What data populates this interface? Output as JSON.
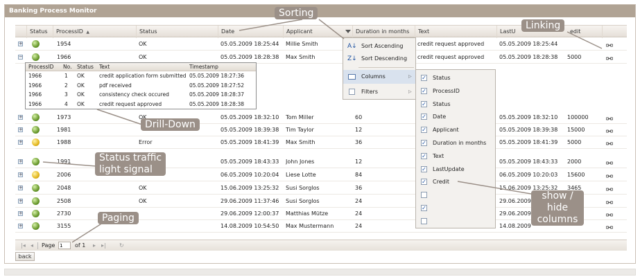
{
  "window": {
    "title": "Banking Process Monitor"
  },
  "grid": {
    "columns": [
      "Status",
      "ProcessID",
      "Status",
      "Date",
      "Applicant",
      "Duration in months",
      "Text",
      "LastU",
      "edit"
    ],
    "sort_indicator": "▲",
    "rows": [
      {
        "expander": "+",
        "light": "green",
        "id": "1954",
        "status": "OK",
        "date": "05.05.2009 18:25:44",
        "applicant": "Millie Smith",
        "duration": "",
        "text": "credit request approved",
        "lastupdate": "05.05.2009 18:25:44",
        "credit": ""
      },
      {
        "expander": "−",
        "light": "green",
        "id": "1966",
        "status": "OK",
        "date": "05.05.2009 18:28:38",
        "applicant": "Max Smith",
        "duration": "",
        "text": "credit request approved",
        "lastupdate": "05.05.2009 18:28:38",
        "credit": "5000"
      },
      {
        "expander": "+",
        "light": "green",
        "id": "1973",
        "status": "OK",
        "date": "05.05.2009 18:32:10",
        "applicant": "Tom Miller",
        "duration": "60",
        "text": "",
        "lastupdate": "05.05.2009 18:32:10",
        "credit": "100000"
      },
      {
        "expander": "+",
        "light": "green",
        "id": "1981",
        "status": "",
        "date": "05.05.2009 18:39:38",
        "applicant": "Tim Taylor",
        "duration": "12",
        "text": "",
        "lastupdate": "05.05.2009 18:39:38",
        "credit": "15000"
      },
      {
        "expander": "+",
        "light": "yellow",
        "id": "1988",
        "status": "Error",
        "date": "05.05.2009 18:41:39",
        "applicant": "Max Smith",
        "duration": "36",
        "text": "",
        "lastupdate": "05.05.2009 18:41:39",
        "credit": "5000"
      },
      {
        "expander": "+",
        "light": "green",
        "id": "1991",
        "status": "",
        "date": "05.05.2009 18:43:33",
        "applicant": "John Jones",
        "duration": "12",
        "text": "",
        "lastupdate": "05.05.2009 18:43:33",
        "credit": "2000"
      },
      {
        "expander": "+",
        "light": "yellow",
        "id": "2006",
        "status": "",
        "date": "06.05.2009 10:20:04",
        "applicant": "Liese Lotte",
        "duration": "84",
        "text": "",
        "lastupdate": "06.05.2009 10:20:03",
        "credit": "15600"
      },
      {
        "expander": "+",
        "light": "green",
        "id": "2048",
        "status": "OK",
        "date": "15.06.2009 13:25:32",
        "applicant": "Susi Sorglos",
        "duration": "36",
        "text": "",
        "lastupdate": "15.06.2009 13:25:32",
        "credit": "3465"
      },
      {
        "expander": "+",
        "light": "green",
        "id": "2508",
        "status": "OK",
        "date": "29.06.2009 11:37:46",
        "applicant": "Susi Sorglos",
        "duration": "24",
        "text": "",
        "lastupdate": "29.06.2009",
        "credit": ""
      },
      {
        "expander": "+",
        "light": "green",
        "id": "2730",
        "status": "",
        "date": "29.06.2009 12:00:37",
        "applicant": "Matthias Mütze",
        "duration": "24",
        "text": "",
        "lastupdate": "29.06.2009",
        "credit": ""
      },
      {
        "expander": "+",
        "light": "green",
        "id": "3155",
        "status": "",
        "date": "14.08.2009 10:54:50",
        "applicant": "Max Mustermann",
        "duration": "24",
        "text": "",
        "lastupdate": "14.08.2009",
        "credit": ""
      }
    ]
  },
  "detail": {
    "columns": [
      "ProcessID",
      "No.",
      "Status",
      "Text",
      "Timestamp"
    ],
    "rows": [
      {
        "pid": "1966",
        "no": "1",
        "status": "OK",
        "text": "credit application form submitted",
        "ts": "05.05.2009 18:27:36"
      },
      {
        "pid": "1966",
        "no": "2",
        "status": "OK",
        "text": "pdf received",
        "ts": "05.05.2009 18:27:52"
      },
      {
        "pid": "1966",
        "no": "3",
        "status": "OK",
        "text": "consistency check occured",
        "ts": "05.05.2009 18:28:37"
      },
      {
        "pid": "1966",
        "no": "4",
        "status": "OK",
        "text": "credit request approved",
        "ts": "05.05.2009 18:28:38"
      }
    ]
  },
  "column_menu": {
    "sort_asc": "Sort Ascending",
    "sort_desc": "Sort Descending",
    "columns": "Columns",
    "filters": "Filters",
    "arrow": "▷"
  },
  "columns_submenu": [
    {
      "label": "Status",
      "checked": true
    },
    {
      "label": "ProcessID",
      "checked": true
    },
    {
      "label": "Status",
      "checked": true
    },
    {
      "label": "Date",
      "checked": true
    },
    {
      "label": "Applicant",
      "checked": true
    },
    {
      "label": "Duration in months",
      "checked": true
    },
    {
      "label": "Text",
      "checked": true
    },
    {
      "label": "LastUpdate",
      "checked": true
    },
    {
      "label": "Credit",
      "checked": true
    },
    {
      "label": "",
      "checked": false
    },
    {
      "label": "",
      "checked": true
    },
    {
      "label": "",
      "checked": false
    }
  ],
  "callouts": {
    "sorting": "Sorting",
    "linking": "Linking",
    "drilldown": "Drill-Down",
    "status_l1": "Status traffic",
    "status_l2": "light signal",
    "paging": "Paging",
    "showhide_l1": "show /",
    "showhide_l2": "hide",
    "showhide_l3": "columns"
  },
  "pager": {
    "page_label": "Page",
    "page_value": "1",
    "of_label": "of 1"
  },
  "back_label": "back",
  "colors": {
    "titlebar": "#b0a394",
    "callout": "#9b9088",
    "accent": "#1a4fa0"
  }
}
